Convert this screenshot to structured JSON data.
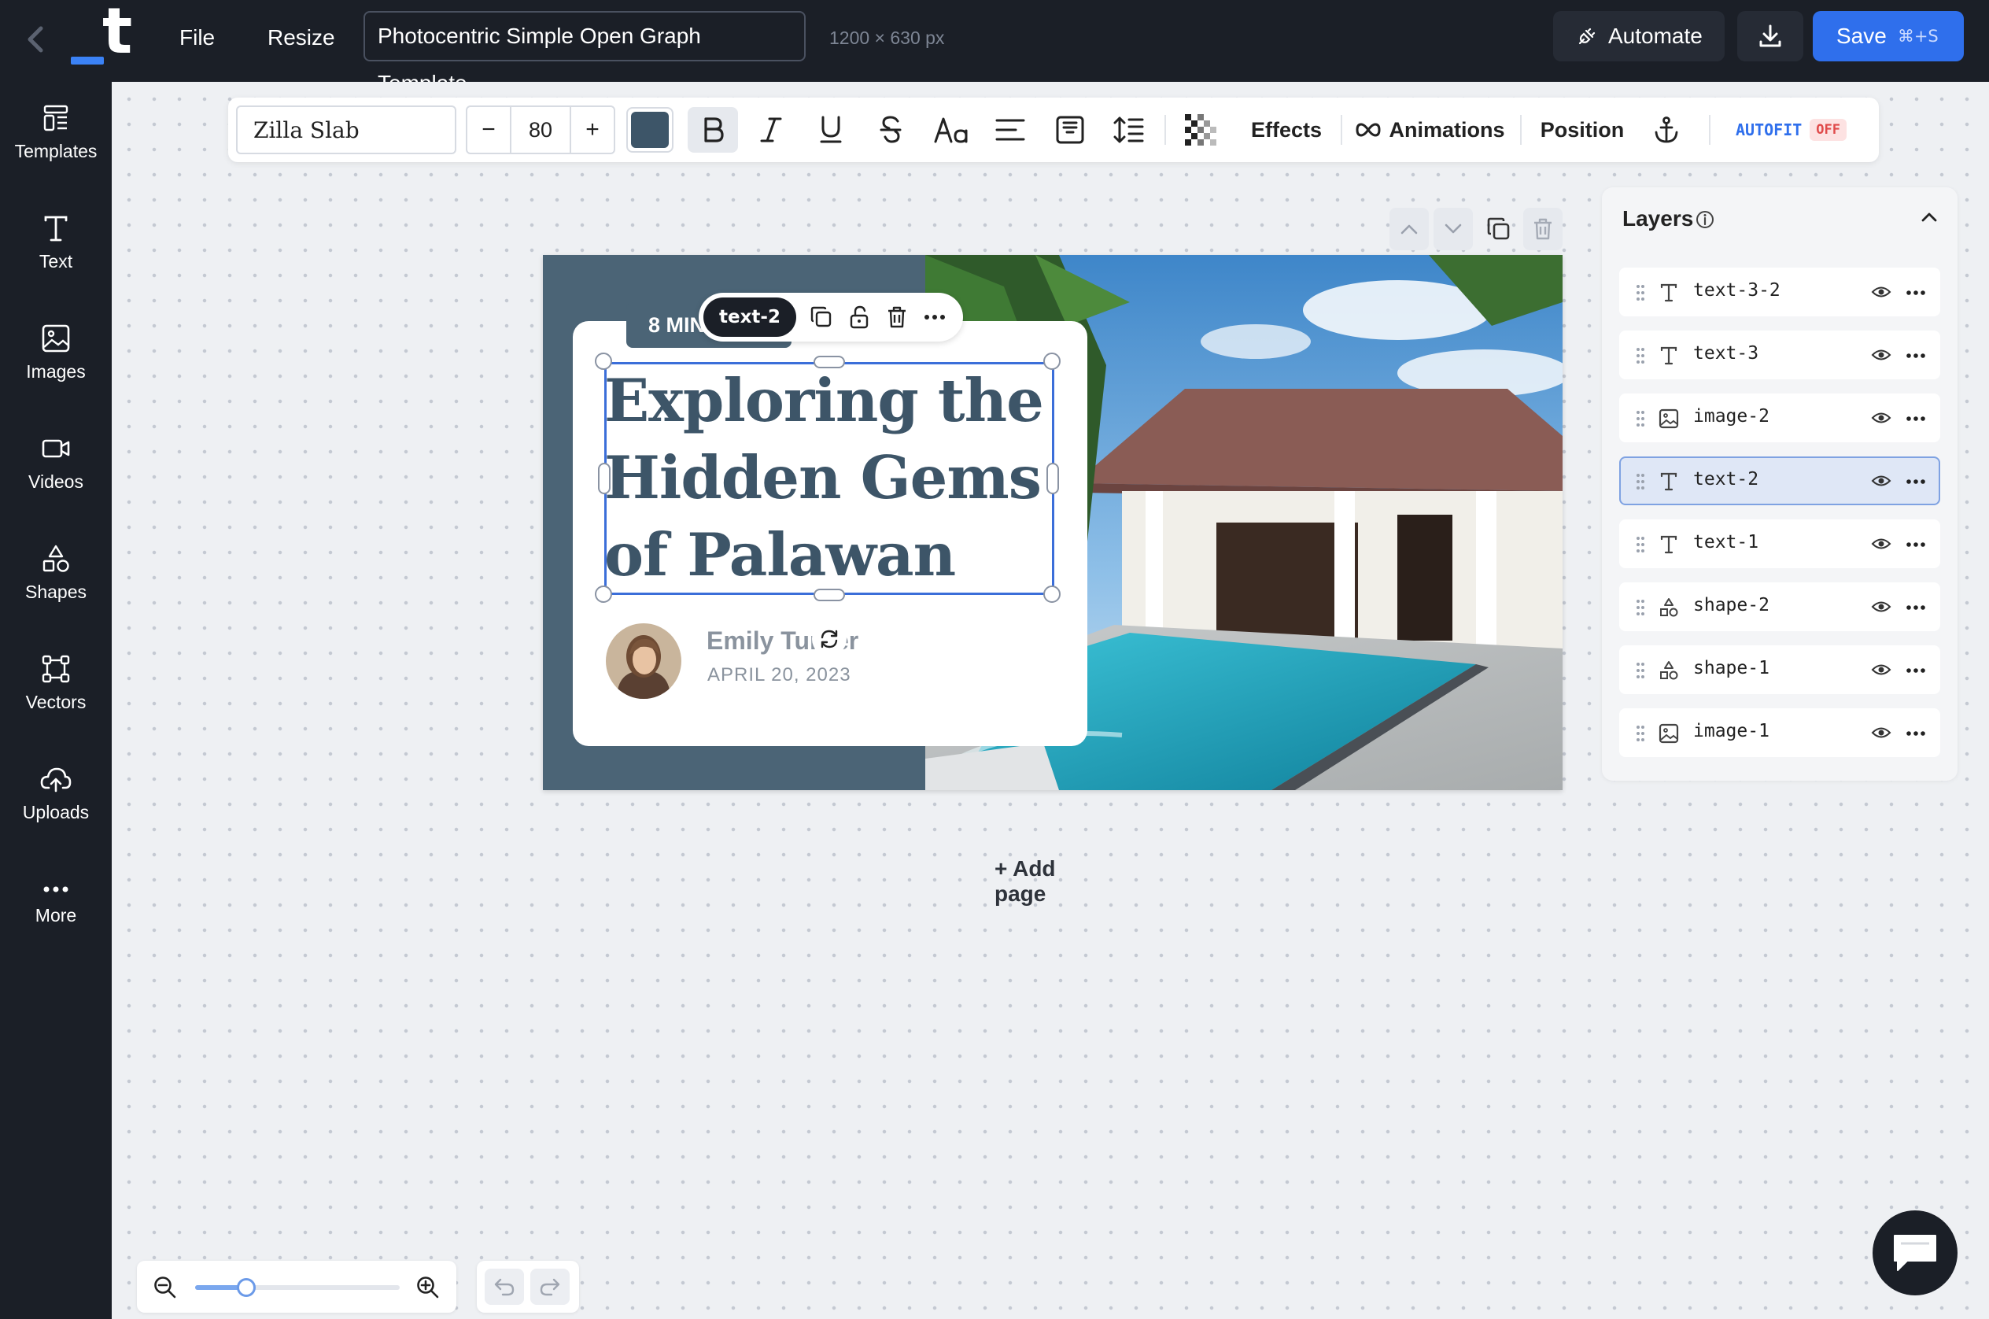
{
  "topbar": {
    "file_label": "File",
    "resize_label": "Resize",
    "document_title": "Photocentric Simple Open Graph Template",
    "size_label": "1200 × 630 px",
    "automate_label": "Automate",
    "save_label": "Save",
    "save_shortcut": "⌘+S"
  },
  "sidebar": {
    "items": [
      {
        "label": "Templates",
        "icon": "templates-icon"
      },
      {
        "label": "Text",
        "icon": "text-icon"
      },
      {
        "label": "Images",
        "icon": "images-icon"
      },
      {
        "label": "Videos",
        "icon": "videos-icon"
      },
      {
        "label": "Shapes",
        "icon": "shapes-icon"
      },
      {
        "label": "Vectors",
        "icon": "vectors-icon"
      },
      {
        "label": "Uploads",
        "icon": "uploads-icon"
      },
      {
        "label": "More",
        "icon": "more-icon"
      }
    ]
  },
  "toolbar": {
    "font_family": "Zilla Slab",
    "font_size": "80",
    "minus": "−",
    "plus": "+",
    "text_color": "#3d5568",
    "effects_label": "Effects",
    "animations_label": "Animations",
    "position_label": "Position",
    "autofit_label": "AUTOFIT",
    "autofit_state": "OFF"
  },
  "design": {
    "tag": "8 MIN",
    "headline_line1": "Exploring the",
    "headline_line2": "Hidden Gems",
    "headline_line3": "of Palawan",
    "author": "Emily Turner",
    "date": "APRIL 20, 2023",
    "background_color": "#4b6476",
    "selected_element": "text-2"
  },
  "canvas": {
    "add_page_label": "+ Add page"
  },
  "layers": {
    "title": "Layers",
    "items": [
      {
        "name": "text-3-2",
        "type": "text"
      },
      {
        "name": "text-3",
        "type": "text"
      },
      {
        "name": "image-2",
        "type": "image"
      },
      {
        "name": "text-2",
        "type": "text",
        "selected": true
      },
      {
        "name": "text-1",
        "type": "text"
      },
      {
        "name": "shape-2",
        "type": "shape"
      },
      {
        "name": "shape-1",
        "type": "shape"
      },
      {
        "name": "image-1",
        "type": "image"
      }
    ]
  },
  "zoom": {
    "level": 0.25
  },
  "colors": {
    "accent": "#2f6fec",
    "dark_ui": "#1b1f27",
    "autofit_off": "#e04a4a"
  }
}
